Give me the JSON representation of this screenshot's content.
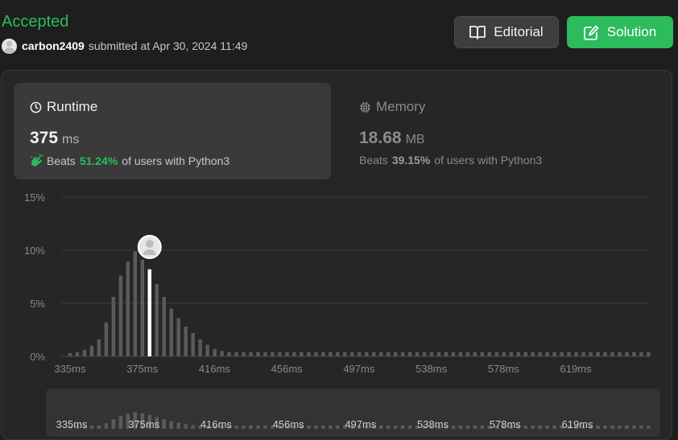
{
  "header": {
    "status": "Accepted",
    "username": "carbon2409",
    "submitted_text": "submitted at Apr 30, 2024 11:49"
  },
  "buttons": {
    "editorial": "Editorial",
    "solution": "Solution"
  },
  "runtime": {
    "title": "Runtime",
    "value": "375",
    "unit": "ms",
    "beats_label": "Beats",
    "beats_pct": "51.24%",
    "beats_suffix": "of users with Python3"
  },
  "memory": {
    "title": "Memory",
    "value": "18.68",
    "unit": "MB",
    "beats_label": "Beats",
    "beats_pct": "39.15%",
    "beats_suffix": "of users with Python3"
  },
  "colors": {
    "accent_green": "#2cbb5d",
    "bar_gray": "#5a5a5a",
    "highlight_bar": "#ffffff"
  },
  "icons": {
    "editorial": "book-open-icon",
    "solution": "edit-icon",
    "runtime": "clock-icon",
    "memory": "chip-icon",
    "beats": "hand-clap-icon"
  },
  "chart_data": {
    "type": "bar",
    "xlabel": "",
    "ylabel": "",
    "ylim": [
      0,
      15
    ],
    "yticks": [
      "15%",
      "10%",
      "5%",
      "0%"
    ],
    "xticks": [
      "335ms",
      "375ms",
      "416ms",
      "456ms",
      "497ms",
      "538ms",
      "578ms",
      "619ms"
    ],
    "highlight_label": "375ms",
    "grid": true,
    "values": [
      0.3,
      0.4,
      0.6,
      1.0,
      1.6,
      3.2,
      5.6,
      7.6,
      8.9,
      9.9,
      9.1,
      8.2,
      6.8,
      5.6,
      4.5,
      3.6,
      2.8,
      2.2,
      1.6,
      1.1,
      0.7,
      0.5,
      0.4,
      0.4,
      0.4,
      0.4,
      0.4,
      0.4,
      0.4,
      0.4,
      0.4,
      0.4,
      0.4,
      0.4,
      0.4,
      0.4,
      0.4,
      0.4,
      0.4,
      0.4,
      0.4,
      0.4,
      0.4,
      0.4,
      0.4,
      0.4,
      0.4,
      0.4,
      0.4,
      0.4,
      0.4,
      0.4,
      0.4,
      0.4,
      0.4,
      0.4,
      0.4,
      0.4,
      0.4,
      0.4,
      0.4,
      0.4,
      0.4,
      0.4,
      0.4,
      0.4,
      0.4,
      0.4,
      0.4,
      0.4,
      0.4,
      0.4,
      0.4,
      0.4,
      0.4,
      0.4,
      0.4,
      0.4,
      0.4,
      0.4,
      0.4
    ],
    "highlight_index": 11
  }
}
